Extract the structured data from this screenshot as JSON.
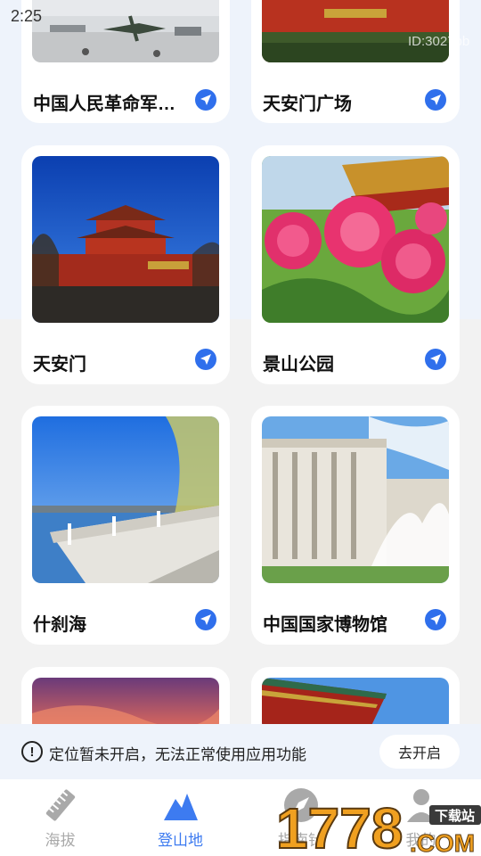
{
  "status_bar": {
    "time": "2:25"
  },
  "watermark": {
    "id_text": "ID:3027bb"
  },
  "cards": [
    {
      "title": "中国人民革命军…",
      "image": "military-museum-photo"
    },
    {
      "title": "天安门广场",
      "image": "tiananmen-square-photo"
    },
    {
      "title": "天安门",
      "image": "tiananmen-gate-photo"
    },
    {
      "title": "景山公园",
      "image": "jingshan-park-peony-photo"
    },
    {
      "title": "什刹海",
      "image": "shichahai-lake-photo"
    },
    {
      "title": "中国国家博物馆",
      "image": "national-museum-photo"
    },
    {
      "title": "",
      "image": "sunset-sky-photo"
    },
    {
      "title": "",
      "image": "red-gate-building-photo"
    }
  ],
  "notice": {
    "text": "定位暂未开启，无法正常使用应用功能",
    "button_label": "去开启"
  },
  "tabs": [
    {
      "label": "海拔",
      "icon": "ruler-icon",
      "active": false
    },
    {
      "label": "登山地",
      "icon": "mountain-icon",
      "active": true
    },
    {
      "label": "指南针",
      "icon": "compass-icon",
      "active": false
    },
    {
      "label": "我的",
      "icon": "person-icon",
      "active": false
    }
  ],
  "logo": {
    "text": "1778",
    "sub": "下载站",
    "domain": ".COM"
  },
  "colors": {
    "accent": "#2f6fec",
    "tab_active": "#3d7bf0",
    "tab_inactive": "#a9a9a9"
  }
}
